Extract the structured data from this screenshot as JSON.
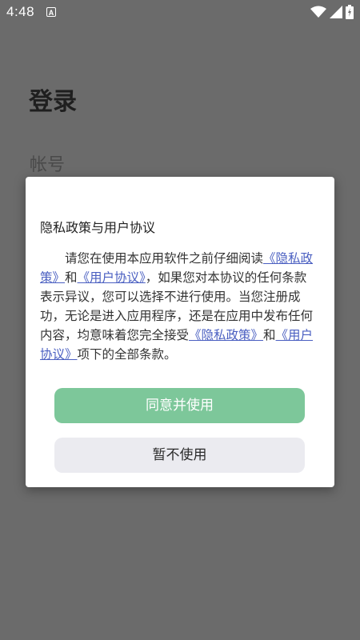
{
  "status_bar": {
    "time": "4:48",
    "notification_icon_letter": "A",
    "icons": [
      "wifi-icon",
      "signal-icon",
      "battery-icon"
    ]
  },
  "background_page": {
    "title": "登录",
    "account_label": "帐号"
  },
  "dialog": {
    "title": "隐私政策与用户协议",
    "body": {
      "p1": "请您在使用本应用软件之前仔细阅读",
      "link_privacy": "《隐私政策》",
      "p2": "和",
      "link_agreement": "《用户协议》",
      "p3": "，如果您对本协议的任何条款表示异议，您可以选择不进行使用。当您注册成功，无论是进入应用程序，还是在应用中发布任何内容，均意味着您完全接受",
      "link_privacy_2": "《隐私政策》",
      "p4": "和",
      "link_agreement_2": "《用户协议》",
      "p5": "项下的全部条款。"
    },
    "agree_button": "同意并使用",
    "decline_button": "暂不使用"
  },
  "colors": {
    "overlay_background": "#6b6b6b",
    "agree_button": "#7dc79a",
    "decline_button": "#ebebf0",
    "link": "#4a5fc1"
  }
}
